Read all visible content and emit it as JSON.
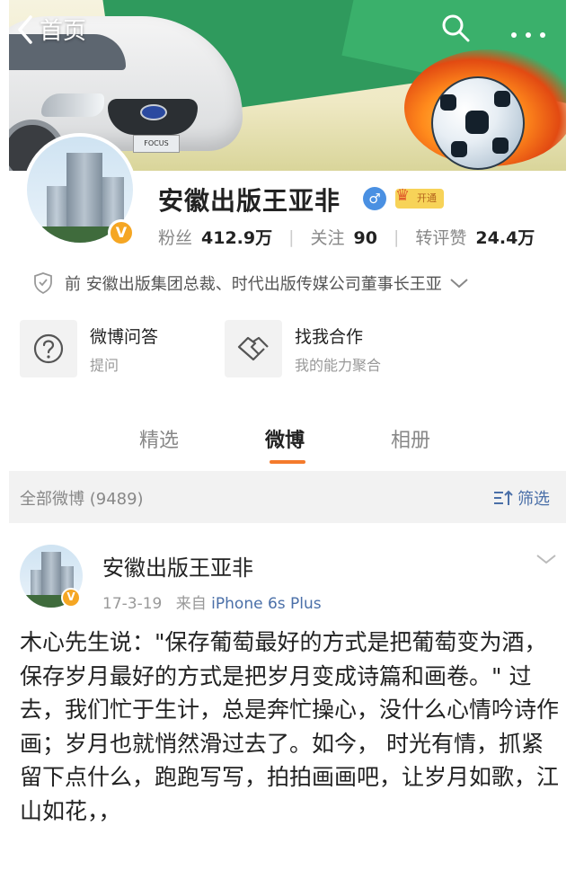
{
  "header": {
    "back_label": "首页",
    "back_icon": "chevron-left-icon",
    "search_icon": "search-icon",
    "more_icon": "more-dots-icon",
    "banner_plate_text": "FOCUS"
  },
  "profile": {
    "name": "安徽出版王亚非",
    "gender_icon": "male-icon",
    "vip_label": "开通",
    "verified_badge": "V",
    "stats": {
      "fans_label": "粉丝",
      "fans_value": "412.9万",
      "follow_label": "关注",
      "follow_value": "90",
      "interactions_label": "转评赞",
      "interactions_value": "24.4万"
    },
    "description": "前 安徽出版集团总裁、时代出版传媒公司董事长王亚"
  },
  "cards": [
    {
      "title": "微博问答",
      "subtitle": "提问",
      "icon": "question-icon"
    },
    {
      "title": "找我合作",
      "subtitle": "我的能力聚合",
      "icon": "handshake-icon"
    }
  ],
  "tabs": [
    {
      "label": "精选",
      "active": false
    },
    {
      "label": "微博",
      "active": true
    },
    {
      "label": "相册",
      "active": false
    }
  ],
  "filter": {
    "all_label": "全部微博 (9489)",
    "filter_label": "筛选"
  },
  "post": {
    "author": "安徽出版王亚非",
    "date": "17-3-19",
    "source_prefix": "来自",
    "source": "iPhone 6s Plus",
    "text": "木心先生说：\"保存葡萄最好的方式是把葡萄变为酒，  保存岁月最好的方式是把岁月变成诗篇和画卷。\"  过去，我们忙于生计，总是奔忙操心，没什么心情吟诗作画；岁月也就悄然滑过去了。如今，  时光有情，抓紧留下点什么，跑跑写写，拍拍画画吧，让岁月如歌，江山如花，，"
  },
  "colors": {
    "accent_orange": "#f47a2c",
    "link_blue": "#4a6fa8",
    "verified_gold": "#f5a623"
  }
}
